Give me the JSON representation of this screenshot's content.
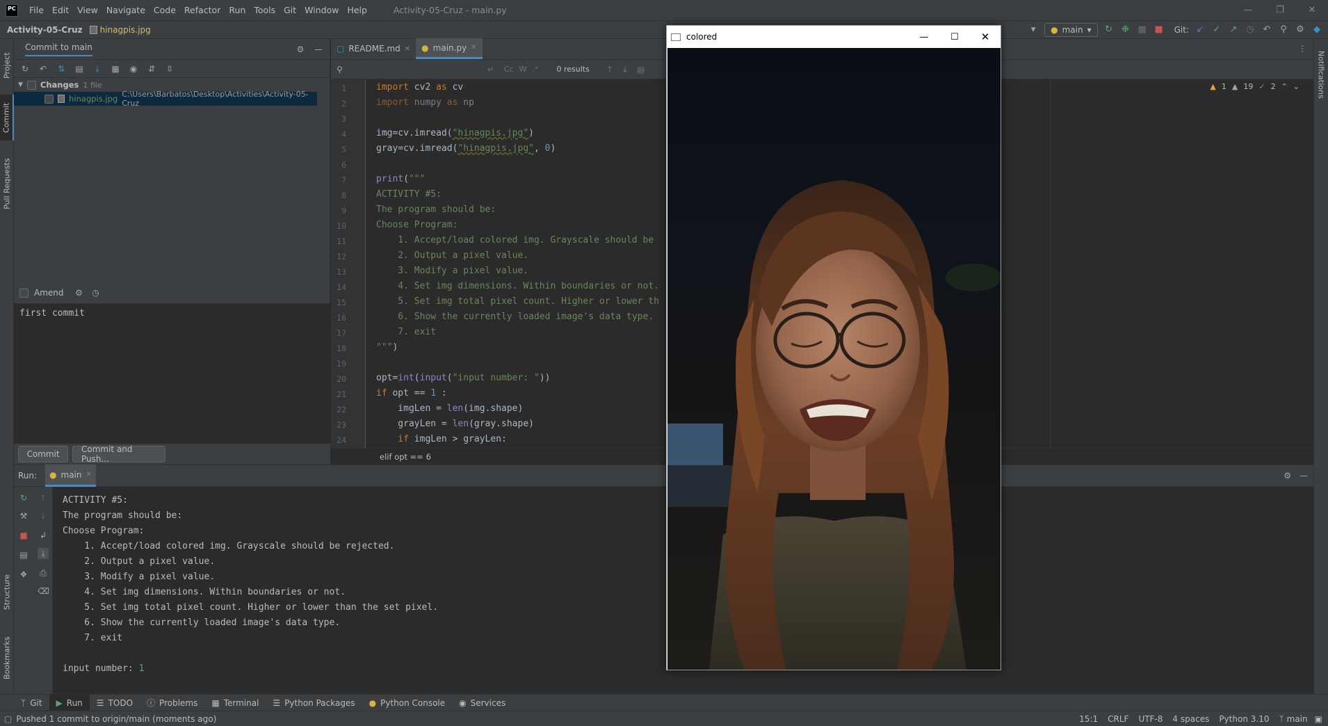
{
  "app": {
    "logo": "PC",
    "menu": [
      "File",
      "Edit",
      "View",
      "Navigate",
      "Code",
      "Refactor",
      "Run",
      "Tools",
      "Git",
      "Window",
      "Help"
    ],
    "title": "Activity-05-Cruz - main.py",
    "window_controls": [
      "minimize-icon",
      "restore-icon",
      "close-icon"
    ]
  },
  "navbar": {
    "project": "Activity-05-Cruz",
    "file": "hinagpis.jpg",
    "branch": "main",
    "git_label": "Git:"
  },
  "left_stripe": {
    "project": "Project",
    "commit": "Commit",
    "pull_requests": "Pull Requests",
    "structure": "Structure",
    "bookmarks": "Bookmarks"
  },
  "right_stripe": {
    "notifications": "Notifications"
  },
  "commit_panel": {
    "title": "Commit to main",
    "changes_label": "Changes",
    "changes_count": "1 file",
    "file_name": "hinagpis.jpg",
    "file_path": "C:\\Users\\Barbatos\\Desktop\\Activities\\Activity-05-Cruz",
    "amend_label": "Amend",
    "message": "first commit",
    "commit_button": "Commit",
    "commit_push_button": "Commit and Push..."
  },
  "editor": {
    "tabs": [
      {
        "label": "README.md",
        "active": false
      },
      {
        "label": "main.py",
        "active": true
      }
    ],
    "search_results": "0 results",
    "search_opts": [
      "Cc",
      "W",
      ".*"
    ],
    "inspections": {
      "warnings": "1",
      "weak_warnings": "19",
      "ok": "2"
    },
    "line_numbers": [
      "1",
      "2",
      "3",
      "4",
      "5",
      "6",
      "7",
      "8",
      "9",
      "10",
      "11",
      "12",
      "13",
      "14",
      "15",
      "16",
      "17",
      "18",
      "19",
      "20",
      "21",
      "22",
      "23",
      "24"
    ],
    "code": {
      "l1_kw": "import",
      "l1_rest": " cv2 ",
      "l1_kw2": "as",
      "l1_rest2": " cv",
      "l2_kw": "import",
      "l2_rest": " numpy ",
      "l2_kw2": "as",
      "l2_rest2": " np",
      "l4_a": "img",
      "l4_b": "=cv.imread(",
      "l4_s": "\"hinagpis.jpg\"",
      "l4_c": ")",
      "l5_a": "gray",
      "l5_b": "=cv.imread(",
      "l5_s": "\"hinagpis.jpg\"",
      "l5_c": ", ",
      "l5_n": "0",
      "l5_d": ")",
      "l7_fn": "print",
      "l7_b": "(",
      "l7_s": "\"\"\"",
      "l8": "ACTIVITY #5:",
      "l9": "The program should be:",
      "l10": "Choose Program:",
      "l11": "    1. Accept/load colored img. Grayscale should be",
      "l12": "    2. Output a pixel value.",
      "l13": "    3. Modify a pixel value.",
      "l14": "    4. Set img dimensions. Within boundaries or not.",
      "l15": "    5. Set img total pixel count. Higher or lower th",
      "l16": "    6. Show the currently loaded image's data type.",
      "l17": "    7. exit",
      "l18_s": "\"\"\"",
      "l18_b": ")",
      "l20_a": "opt",
      "l20_b": "=",
      "l20_fn": "int",
      "l20_c": "(",
      "l20_fn2": "input",
      "l20_d": "(",
      "l20_s": "\"input number: \"",
      "l20_e": "))",
      "l21_kw": "if",
      "l21_b": " opt == ",
      "l21_n": "1",
      "l21_c": " :",
      "l22_a": "    imgLen = ",
      "l22_fn": "len",
      "l22_b": "(img.shape)",
      "l23_a": "    grayLen = ",
      "l23_fn": "len",
      "l23_b": "(gray.shape)",
      "l24_a": "    ",
      "l24_kw": "if",
      "l24_b": " imgLen > grayLen:"
    },
    "breadcrumb": "elif opt == 6"
  },
  "run_panel": {
    "label": "Run:",
    "tab": "main",
    "console": [
      "ACTIVITY #5:",
      "The program should be:",
      "Choose Program:",
      "    1. Accept/load colored img. Grayscale should be rejected.",
      "    2. Output a pixel value.",
      "    3. Modify a pixel value.",
      "    4. Set img dimensions. Within boundaries or not.",
      "    5. Set img total pixel count. Higher or lower than the set pixel.",
      "    6. Show the currently loaded image's data type.",
      "    7. exit",
      "",
      "input number: "
    ],
    "input_value": "1"
  },
  "bottom_tools": [
    "Git",
    "Run",
    "TODO",
    "Problems",
    "Terminal",
    "Python Packages",
    "Python Console",
    "Services"
  ],
  "status": {
    "message": "Pushed 1 commit to origin/main (moments ago)",
    "position": "15:1",
    "line_sep": "CRLF",
    "encoding": "UTF-8",
    "indent": "4 spaces",
    "interpreter": "Python 3.10",
    "branch": "main"
  },
  "image_window": {
    "title": "colored",
    "content": "photo-of-person-crying"
  },
  "colors": {
    "bg": "#2b2b2b",
    "panel": "#3c3f41",
    "keyword": "#cc7832",
    "string": "#6a8759",
    "number": "#6897bb",
    "accent": "#4a88c7",
    "modified_file": "#6a8759"
  }
}
